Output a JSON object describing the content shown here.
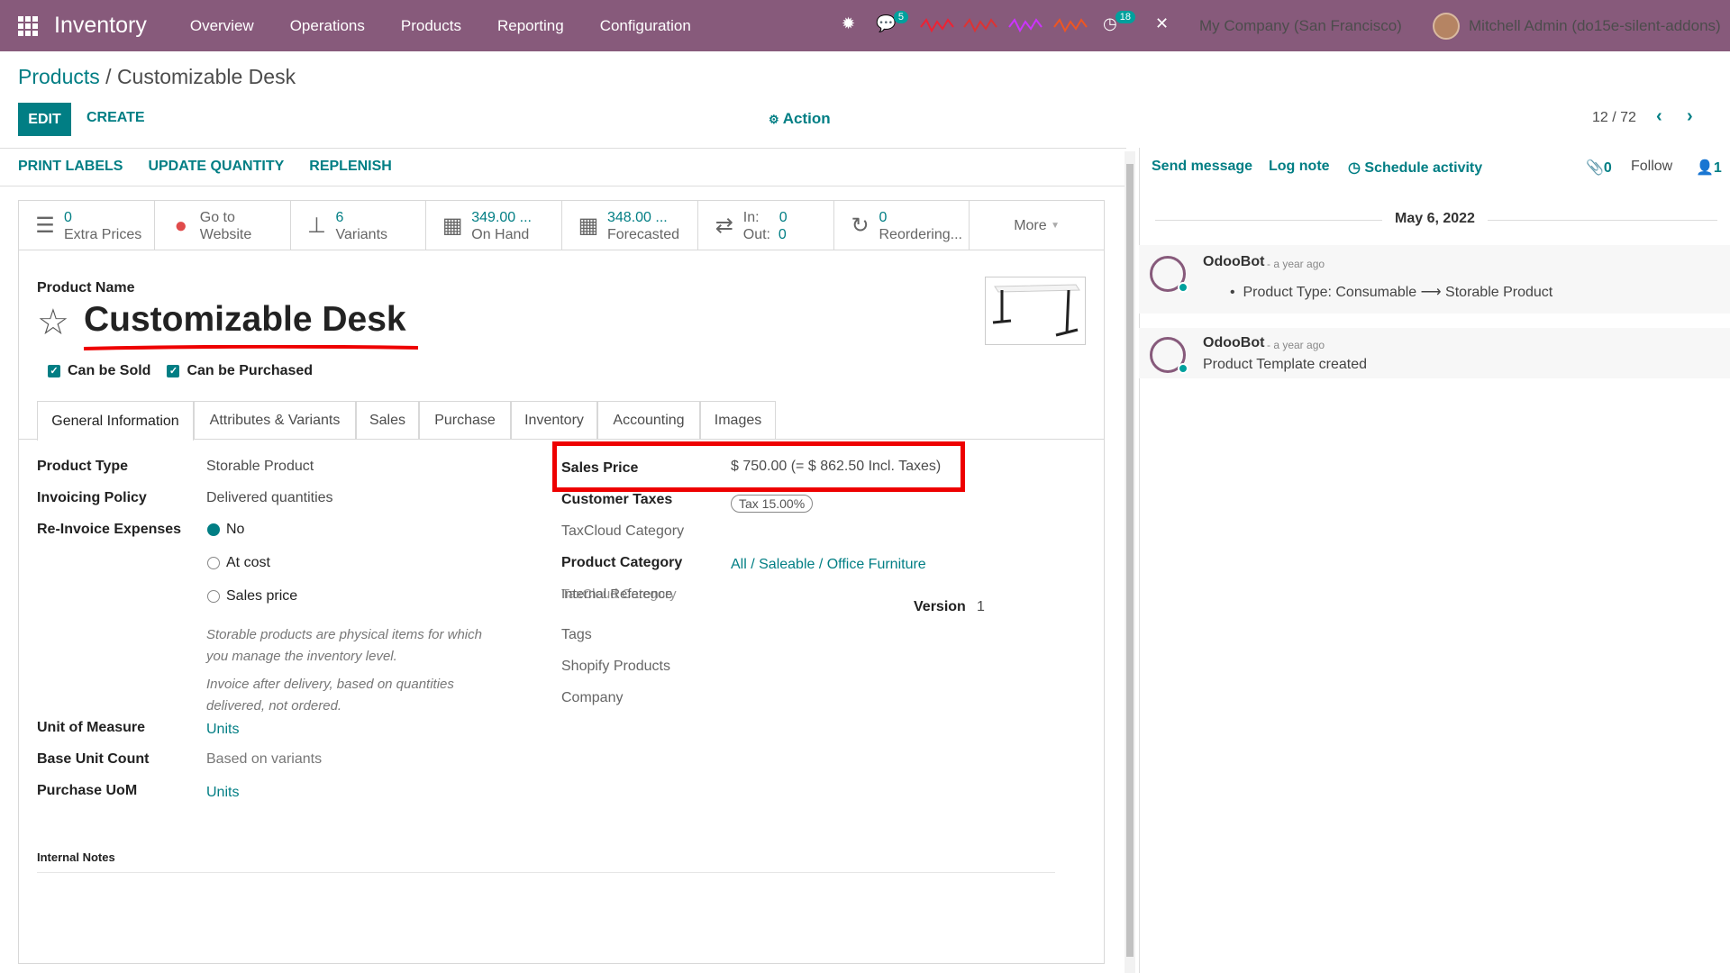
{
  "navbar": {
    "app_name": "Inventory",
    "menus": [
      "Overview",
      "Operations",
      "Products",
      "Reporting",
      "Configuration"
    ],
    "messages_badge": "5",
    "activity_badge": "18",
    "company": "My Company (San Francisco)",
    "user": "Mitchell Admin (do15e-silent-addons)"
  },
  "breadcrumb": {
    "parent": "Products",
    "separator": " / ",
    "current": "Customizable Desk"
  },
  "control": {
    "edit": "EDIT",
    "create": "CREATE",
    "action": "Action",
    "pager": "12 / 72"
  },
  "statusbar": {
    "buttons": [
      "PRINT LABELS",
      "UPDATE QUANTITY",
      "REPLENISH"
    ]
  },
  "smart_buttons": [
    {
      "icon": "list-icon",
      "num": "0",
      "label": "Extra Prices"
    },
    {
      "icon": "globe-icon",
      "num": "Go to",
      "label": "Website"
    },
    {
      "icon": "sitemap-icon",
      "num": "6",
      "label": "Variants"
    },
    {
      "icon": "cubes-icon",
      "num": "349.00 ...",
      "label": "On Hand"
    },
    {
      "icon": "cubes-icon",
      "num": "348.00 ...",
      "label": "Forecasted"
    },
    {
      "icon": "exchange-icon",
      "in_label": "In:",
      "in_val": "0",
      "out_label": "Out:",
      "out_val": "0"
    },
    {
      "icon": "refresh-icon",
      "num": "0",
      "label": "Reordering..."
    }
  ],
  "smart_more": "More",
  "product": {
    "name_label": "Product Name",
    "name": "Customizable Desk",
    "can_be_sold": "Can be Sold",
    "can_be_purchased": "Can be Purchased"
  },
  "tabs": [
    "General Information",
    "Attributes & Variants",
    "Sales",
    "Purchase",
    "Inventory",
    "Accounting",
    "Images"
  ],
  "general": {
    "product_type_label": "Product Type",
    "product_type": "Storable Product",
    "invoicing_policy_label": "Invoicing Policy",
    "invoicing_policy": "Delivered quantities",
    "reinvoice_label": "Re-Invoice Expenses",
    "reinvoice_options": [
      "No",
      "At cost",
      "Sales price"
    ],
    "hint1a": "Storable products are physical items for which",
    "hint1b": "you manage the inventory level.",
    "hint2a": "Invoice after delivery, based on quantities",
    "hint2b": "delivered, not ordered.",
    "uom_label": "Unit of Measure",
    "uom": "Units",
    "base_unit_label": "Base Unit Count",
    "base_unit": "Based on variants",
    "purchase_uom_label": "Purchase UoM",
    "purchase_uom": "Units",
    "sales_price_label": "Sales Price",
    "sales_price": "$ 750.00  (= $ 862.50 Incl. Taxes)",
    "customer_taxes_label": "Customer Taxes",
    "customer_taxes": "Tax 15.00%",
    "taxcloud_label": "TaxCloud Category",
    "category_label": "Product Category",
    "category": "All / Saleable / Office Furniture",
    "internal_ref_label": "Internal Reference",
    "internal_ref_overlap": "TaxCloud Category",
    "version_label": "Version",
    "version": "1",
    "tags_label": "Tags",
    "shopify_label": "Shopify Products",
    "company_label": "Company",
    "internal_notes_label": "Internal Notes"
  },
  "chatter": {
    "send_message": "Send message",
    "log_note": "Log note",
    "schedule_activity": "Schedule activity",
    "attachments": "0",
    "follow": "Follow",
    "followers": "1",
    "date": "May 6, 2022",
    "messages": [
      {
        "author": "OdooBot",
        "ago": "- a year ago",
        "body_prefix": "Product Type: Consumable",
        "body_arrow": "⟶",
        "body_suffix": "Storable Product"
      },
      {
        "author": "OdooBot",
        "ago": "- a year ago",
        "body": "Product Template created"
      }
    ]
  },
  "colors": {
    "brand": "#875a7b",
    "accent": "#017e84",
    "highlight": "#e00000"
  }
}
